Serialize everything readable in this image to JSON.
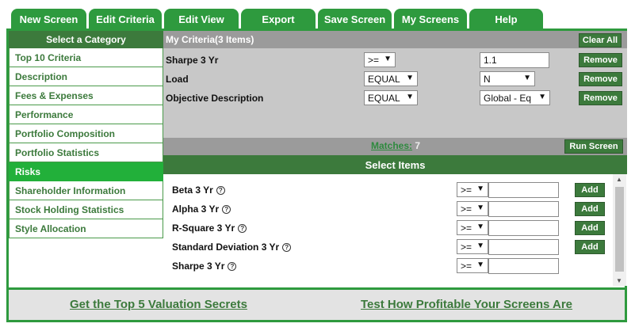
{
  "tabs": [
    "New Screen",
    "Edit Criteria",
    "Edit View",
    "Export",
    "Save Screen",
    "My Screens",
    "Help"
  ],
  "sidebar": {
    "title": "Select a Category",
    "items": [
      "Top 10 Criteria",
      "Description",
      "Fees & Expenses",
      "Performance",
      "Portfolio Composition",
      "Portfolio Statistics",
      "Risks",
      "Shareholder Information",
      "Stock Holding Statistics",
      "Style Allocation"
    ],
    "active_index": 6
  },
  "criteria": {
    "title": "My Criteria(3 Items)",
    "clear_all": "Clear All",
    "remove": "Remove",
    "rows": [
      {
        "label": "Sharpe 3 Yr",
        "operator": ">=",
        "value": "1.1",
        "value_type": "input"
      },
      {
        "label": "Load",
        "operator": "EQUAL",
        "value": "N",
        "value_type": "select"
      },
      {
        "label": "Objective Description",
        "operator": "EQUAL",
        "value": "Global - Eq",
        "value_type": "select"
      }
    ]
  },
  "matches": {
    "label": "Matches:",
    "count": "7",
    "run": "Run Screen"
  },
  "select_items": {
    "title": "Select Items",
    "add": "Add",
    "rows": [
      {
        "label": "Beta 3 Yr",
        "operator": ">=",
        "value": "",
        "has_add": true
      },
      {
        "label": "Alpha 3 Yr",
        "operator": ">=",
        "value": "",
        "has_add": true
      },
      {
        "label": "R-Square 3 Yr",
        "operator": ">=",
        "value": "",
        "has_add": true
      },
      {
        "label": "Standard Deviation 3 Yr",
        "operator": ">=",
        "value": "",
        "has_add": true
      },
      {
        "label": "Sharpe 3 Yr",
        "operator": ">=",
        "value": "",
        "has_add": false
      }
    ]
  },
  "footer": {
    "link1": "Get the Top 5 Valuation Secrets",
    "link2": "Test How Profitable Your Screens Are"
  },
  "icons": {
    "help": "question-circle-icon",
    "dropdown": "caret-down-icon"
  },
  "colors": {
    "brand_green": "#2e9a3e",
    "dark_green": "#3c7a3c",
    "active_green": "#22b03a",
    "gray_header": "#9b9b9b",
    "panel_gray": "#c8c8c8"
  }
}
